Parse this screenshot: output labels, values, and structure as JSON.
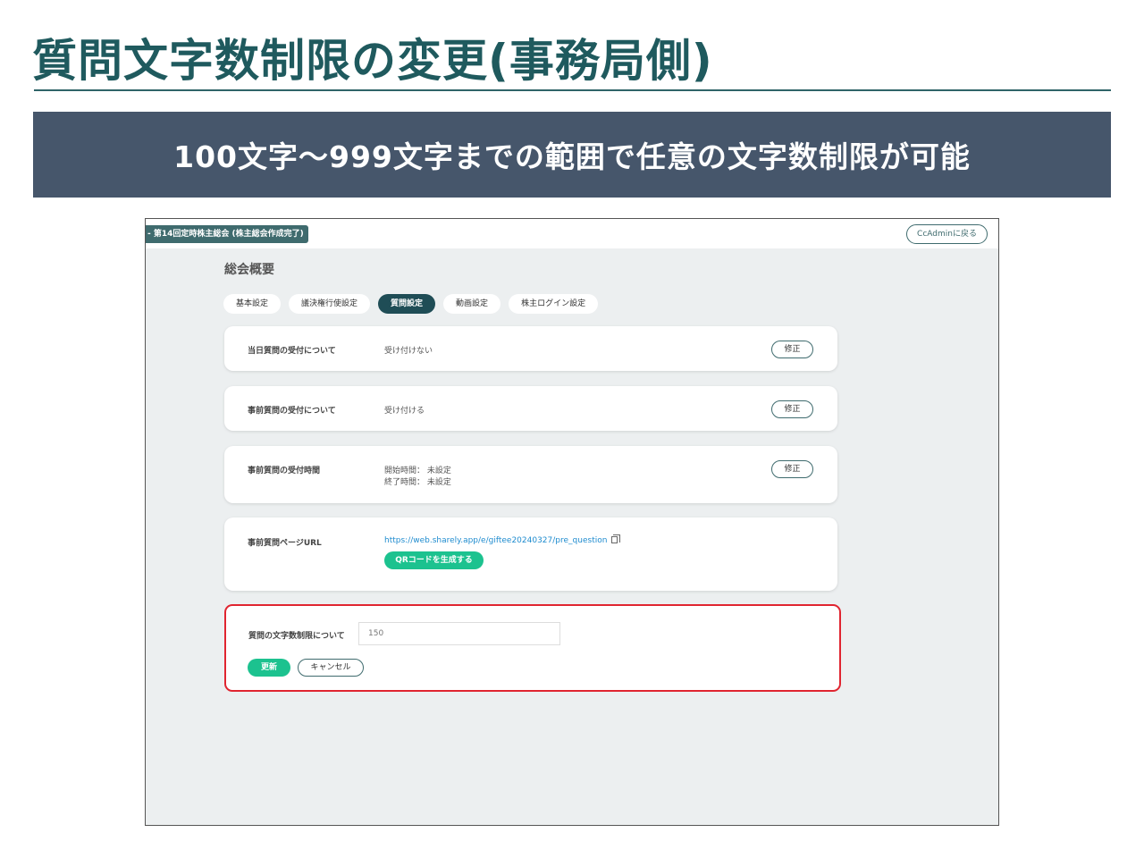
{
  "slide": {
    "title": "質問文字数制限の変更(事務局側)",
    "banner": "100文字〜999文字までの範囲で任意の文字数制限が可能"
  },
  "app": {
    "status_pill": "- 第14回定時株主総会 (株主総会作成完了)",
    "back_button": "CcAdminに戻る",
    "section_title": "総会概要",
    "tabs": [
      {
        "label": "基本設定",
        "active": false
      },
      {
        "label": "議決権行使設定",
        "active": false
      },
      {
        "label": "質問設定",
        "active": true
      },
      {
        "label": "動画設定",
        "active": false
      },
      {
        "label": "株主ログイン設定",
        "active": false
      }
    ],
    "cards": [
      {
        "label": "当日質問の受付について",
        "value": "受け付けない",
        "edit": "修正"
      },
      {
        "label": "事前質問の受付について",
        "value": "受け付ける",
        "edit": "修正"
      },
      {
        "label": "事前質問の受付時間",
        "value_start": "開始時間： 未設定",
        "value_end": "終了時間： 未設定",
        "edit": "修正"
      },
      {
        "label": "事前質問ページURL",
        "url": "https://web.sharely.app/e/giftee20240327/pre_question",
        "qr_button": "QRコードを生成する"
      }
    ],
    "limit": {
      "label": "質問の文字数制限について",
      "value": "150",
      "update_button": "更新",
      "cancel_button": "キャンセル"
    }
  },
  "colors": {
    "title": "#1f5a5e",
    "banner_bg": "#46566b",
    "primary_green": "#1cc28f",
    "active_tab": "#1f4d56",
    "highlight": "#e02530"
  }
}
